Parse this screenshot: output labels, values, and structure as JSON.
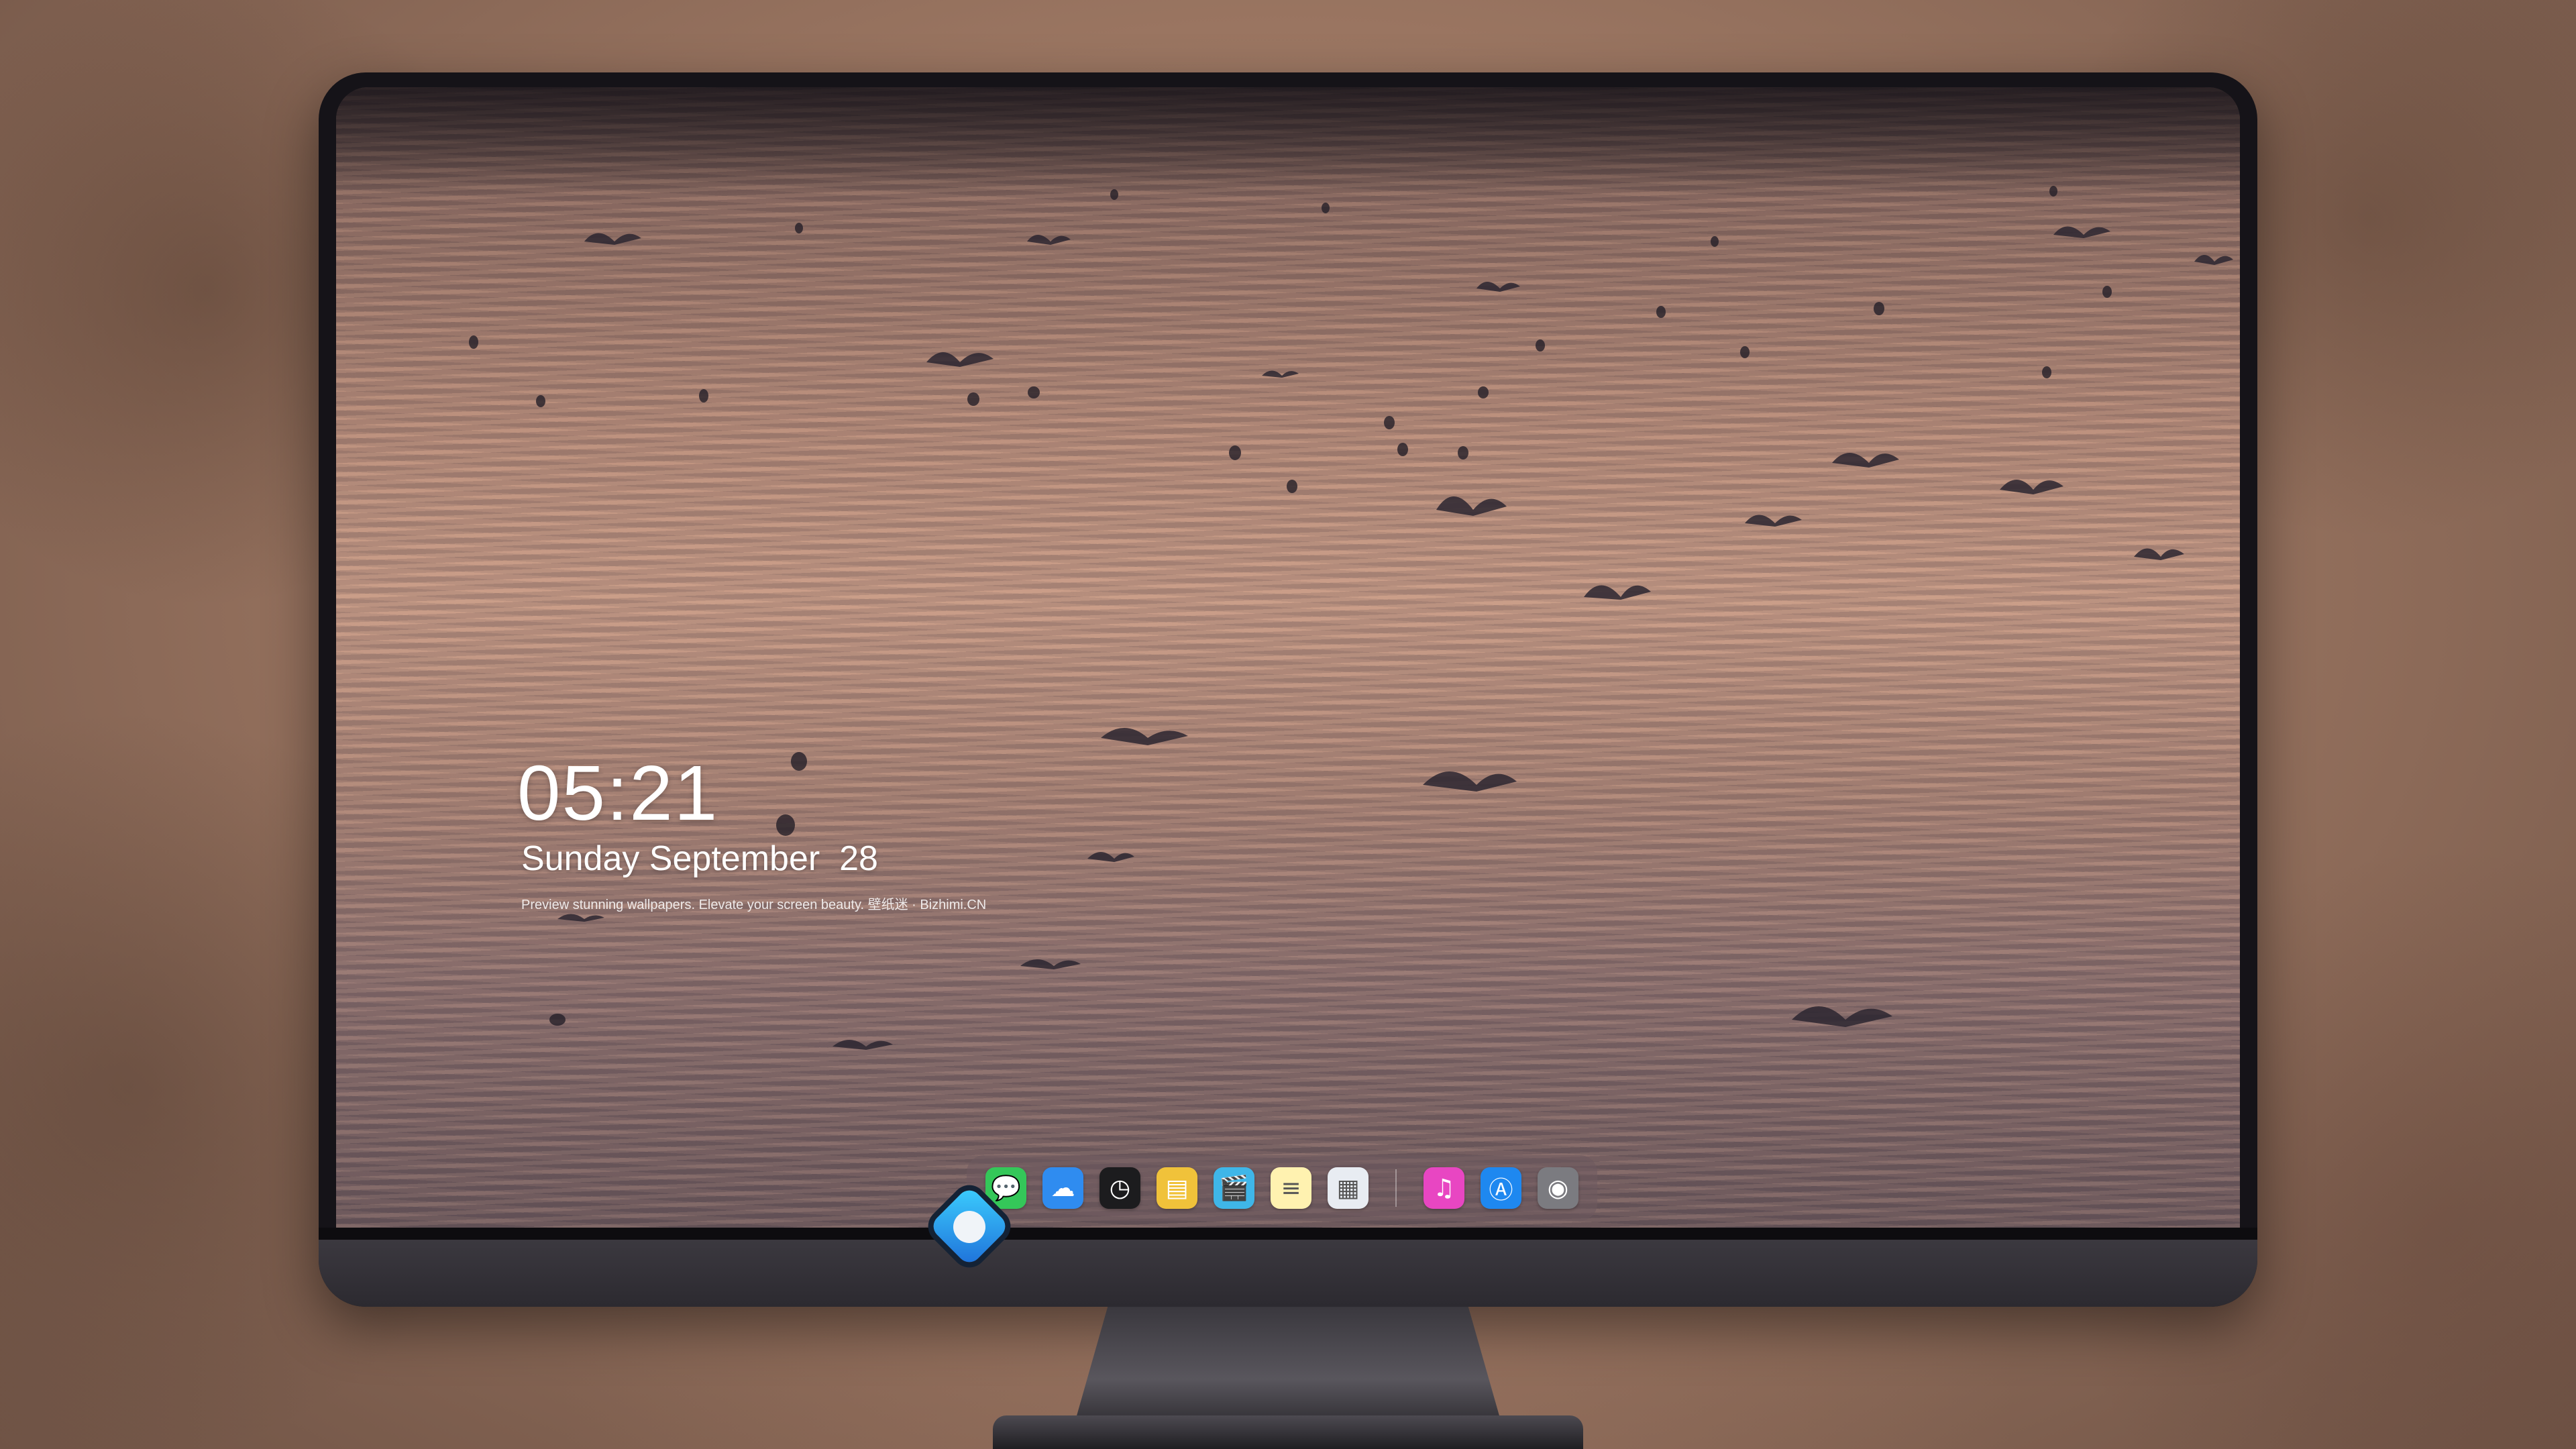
{
  "lock_screen": {
    "time": "05:21",
    "date": "Sunday September  28",
    "tagline": "Preview stunning wallpapers. Elevate your screen beauty. 壁纸迷 · Bizhimi.CN"
  },
  "dock": {
    "apps": [
      {
        "name": "Messages",
        "icon": "messages-icon",
        "glyph": "💬",
        "color": "#34c759"
      },
      {
        "name": "Weather",
        "icon": "weather-icon",
        "glyph": "☁",
        "color": "#2f8cf0"
      },
      {
        "name": "Clock",
        "icon": "clock-icon",
        "glyph": "◷",
        "color": "#1c1c1e"
      },
      {
        "name": "Preview",
        "icon": "preview-icon",
        "glyph": "▤",
        "color": "#f0c23a"
      },
      {
        "name": "Clips",
        "icon": "clapperboard-icon",
        "glyph": "🎬",
        "color": "#3fb6e8"
      },
      {
        "name": "Notes",
        "icon": "notes-icon",
        "glyph": "≡",
        "color": "#fff2b0"
      },
      {
        "name": "Photo Booth",
        "icon": "photos-grid-icon",
        "glyph": "▦",
        "color": "#e8ecf2"
      },
      {
        "name": "Music",
        "icon": "music-icon",
        "glyph": "♫",
        "color": "#e846c2"
      },
      {
        "name": "App Store",
        "icon": "app-store-icon",
        "glyph": "Ⓐ",
        "color": "#1e88f0"
      },
      {
        "name": "Camera",
        "icon": "camera-icon",
        "glyph": "◉",
        "color": "#7b7b80"
      }
    ]
  }
}
